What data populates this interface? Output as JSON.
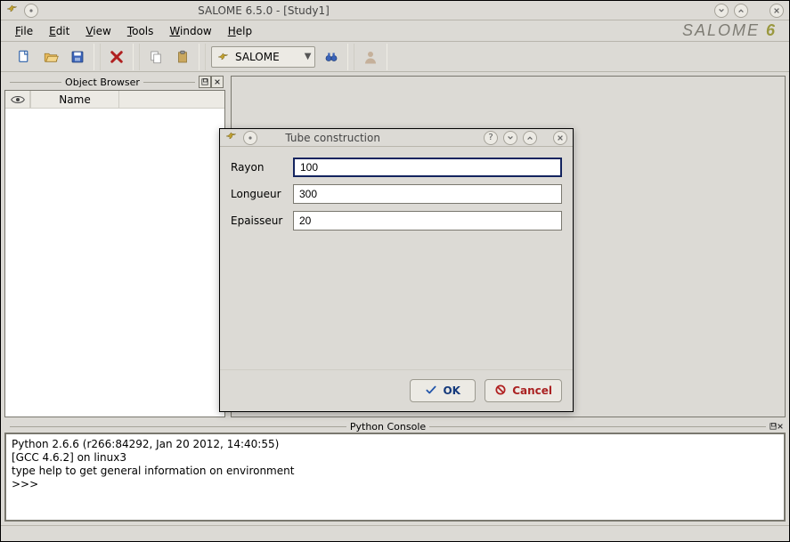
{
  "window": {
    "title": "SALOME 6.5.0 - [Study1]",
    "brand": "SALOME",
    "brand_suffix": "6"
  },
  "menubar": {
    "file": "File",
    "edit": "Edit",
    "view": "View",
    "tools": "Tools",
    "window": "Window",
    "help": "Help"
  },
  "toolbar": {
    "module_selected": "SALOME"
  },
  "browser": {
    "title": "Object Browser",
    "col_name": "Name"
  },
  "console": {
    "title": "Python Console",
    "line1": "Python 2.6.6 (r266:84292, Jan 20 2012, 14:40:55)",
    "line2": "[GCC 4.6.2] on linux3",
    "line3": "type help to get general information on environment",
    "prompt": ">>>"
  },
  "dialog": {
    "title": "Tube construction",
    "fields": {
      "rayon_label": "Rayon",
      "rayon_value": "100",
      "longueur_label": "Longueur",
      "longueur_value": "300",
      "epaisseur_label": "Epaisseur",
      "epaisseur_value": "20"
    },
    "buttons": {
      "ok": "OK",
      "cancel": "Cancel"
    }
  }
}
